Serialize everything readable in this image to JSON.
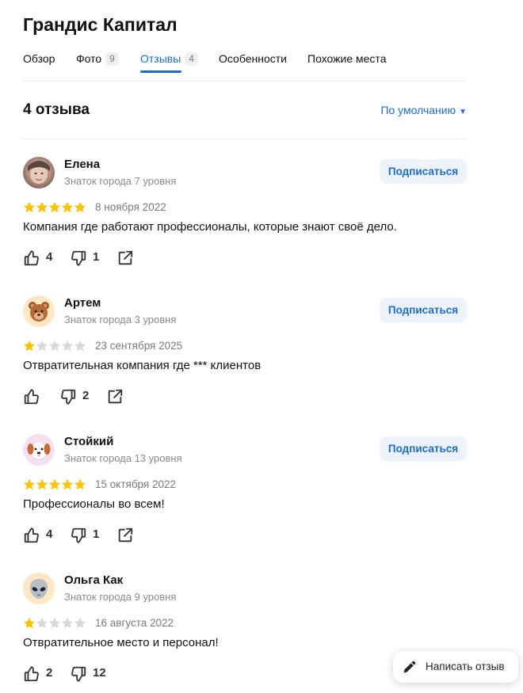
{
  "page": {
    "title": "Грандис Капитал"
  },
  "tabs": [
    {
      "label": "Обзор",
      "count": null,
      "active": false
    },
    {
      "label": "Фото",
      "count": "9",
      "active": false
    },
    {
      "label": "Отзывы",
      "count": "4",
      "active": true
    },
    {
      "label": "Особенности",
      "count": null,
      "active": false
    },
    {
      "label": "Похожие места",
      "count": null,
      "active": false
    }
  ],
  "reviews_header": {
    "count_title": "4 отзыва",
    "sort_label": "По умолчанию"
  },
  "reviews": [
    {
      "author": "Елена",
      "level": "Знаток города 7 уровня",
      "rating": 5,
      "date": "8 ноября 2022",
      "text": "Компания где работают профессионалы, которые знают своё дело.",
      "likes": "4",
      "dislikes": "1",
      "subscribe_label": "Подписаться",
      "avatar": "photo"
    },
    {
      "author": "Артем",
      "level": "Знаток города 3 уровня",
      "rating": 1,
      "date": "23 сентября 2025",
      "text": "Отвратительная компания где *** клиентов",
      "likes": "",
      "dislikes": "2",
      "subscribe_label": "Подписаться",
      "avatar": "bear-emoji"
    },
    {
      "author": "Стойкий",
      "level": "Знаток города 13 уровня",
      "rating": 5,
      "date": "15 октября 2022",
      "text": "Профессионалы во всем!",
      "likes": "4",
      "dislikes": "1",
      "subscribe_label": "Подписаться",
      "avatar": "dog-emoji"
    },
    {
      "author": "Ольга Как",
      "level": "Знаток города 9 уровня",
      "rating": 1,
      "date": "16 августа 2022",
      "text": "Отвратительное место и персонал!",
      "likes": "2",
      "dislikes": "12",
      "subscribe_label": "",
      "avatar": "alien-emoji"
    }
  ],
  "write_review": {
    "label": "Написать отзыв"
  },
  "colors": {
    "accent": "#1a6dd9",
    "star_filled": "#fcc400",
    "star_empty": "#d9d9d9",
    "subscribe_bg": "#eef3fb"
  }
}
